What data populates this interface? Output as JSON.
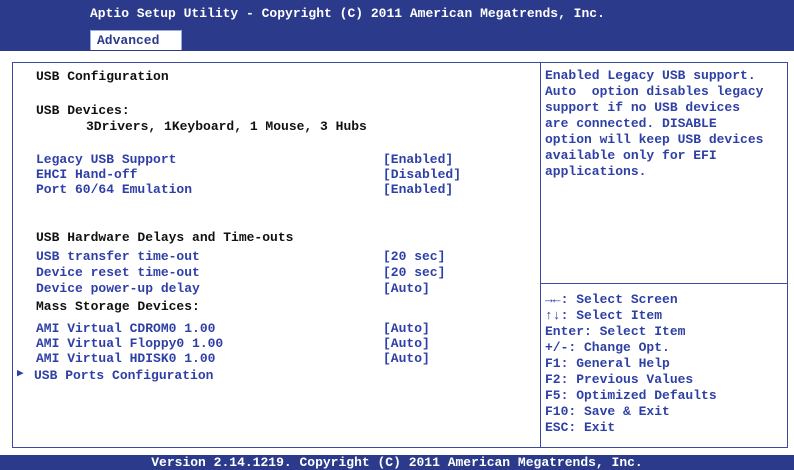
{
  "header": {
    "title": "Aptio Setup Utility - Copyright (C) 2011 American Megatrends, Inc.",
    "tab": "Advanced"
  },
  "main": {
    "heading": "USB Configuration",
    "devices_label": "USB Devices:",
    "devices_value": "3Drivers, 1Keyboard, 1 Mouse, 3 Hubs",
    "settings": [
      {
        "label": "Legacy USB Support",
        "value": "[Enabled]"
      },
      {
        "label": "EHCI Hand-off",
        "value": "[Disabled]"
      },
      {
        "label": "Port 60/64 Emulation",
        "value": "[Enabled]"
      }
    ],
    "delays_heading": "USB Hardware Delays and Time-outs",
    "delays": [
      {
        "label": "USB transfer time-out",
        "value": "[20 sec]"
      },
      {
        "label": "Device reset time-out",
        "value": "[20 sec]"
      },
      {
        "label": "Device power-up delay",
        "value": "[Auto]"
      }
    ],
    "mass_heading": "Mass Storage Devices:",
    "mass": [
      {
        "label": "AMI Virtual CDROM0 1.00",
        "value": "[Auto]"
      },
      {
        "label": "AMI Virtual Floppy0 1.00",
        "value": "[Auto]"
      },
      {
        "label": "AMI Virtual HDISK0 1.00",
        "value": "[Auto]"
      }
    ],
    "submenu": "USB Ports Configuration"
  },
  "help_text": "Enabled Legacy USB support.\nAuto  option disables legacy\nsupport if no USB devices\nare connected. DISABLE\noption will keep USB devices\navailable only for EFI\napplications.",
  "keys": [
    "→←: Select Screen",
    "↑↓:  Select Item",
    "Enter: Select Item",
    "+/-: Change Opt.",
    "F1: General Help",
    "F2: Previous Values",
    "F5: Optimized Defaults",
    "F10: Save & Exit",
    "ESC: Exit"
  ],
  "footer": "Version 2.14.1219. Copyright (C) 2011 American Megatrends, Inc."
}
